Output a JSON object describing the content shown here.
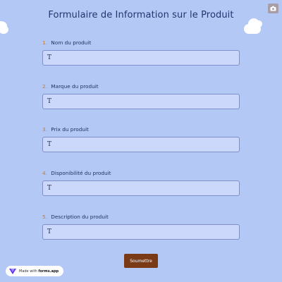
{
  "header": {
    "title": "Formulaire de Information sur le Produit"
  },
  "questions": [
    {
      "number": "1.",
      "label": "Nom du produit",
      "value": "T"
    },
    {
      "number": "2.",
      "label": "Marque du produit",
      "value": "T"
    },
    {
      "number": "3.",
      "label": "Prix du produit",
      "value": "T"
    },
    {
      "number": "4.",
      "label": "Disponibilité du produit",
      "value": "T"
    },
    {
      "number": "5.",
      "label": "Description du produit",
      "value": "T"
    }
  ],
  "submit": {
    "label": "Soumettre"
  },
  "branding": {
    "prefix": "Made with",
    "name": "forms.app"
  },
  "colors": {
    "background": "#b3c8f5",
    "title": "#22356f",
    "question_number": "#c57b2d",
    "input_background": "#cbd7fb",
    "input_border": "#7e90c7",
    "submit_button": "#7b3a16"
  },
  "icons": {
    "corner_button": "camera-icon",
    "brand_logo": "forms-app-logo-icon"
  }
}
